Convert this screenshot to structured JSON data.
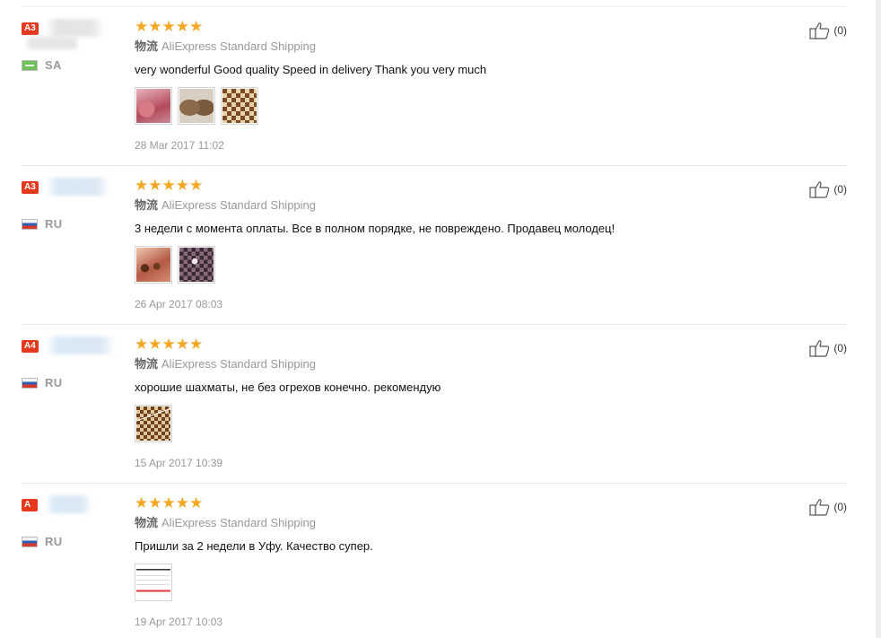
{
  "reviews": [
    {
      "level": "A3",
      "country": "SA",
      "flag": "sa",
      "stars": "★★★★★",
      "shipping_label": "物流",
      "shipping": "AliExpress Standard Shipping",
      "feedback": "very wonderful Good quality Speed in delivery Thank you very much",
      "photos": [
        "ph-pinkbox",
        "ph-bags",
        "ph-board"
      ],
      "date": "28 Mar 2017 11:02",
      "helpful": "(0)"
    },
    {
      "level": "A3",
      "country": "RU",
      "flag": "ru",
      "stars": "★★★★★",
      "shipping_label": "物流",
      "shipping": "AliExpress Standard Shipping",
      "feedback": "3 недели с момента оплаты. Все в полном порядке, не повреждено. Продавец молодец!",
      "photos": [
        "ph-pieces",
        "ph-dark"
      ],
      "date": "26 Apr 2017 08:03",
      "helpful": "(0)"
    },
    {
      "level": "A4",
      "country": "RU",
      "flag": "ru",
      "stars": "★★★★★",
      "shipping_label": "物流",
      "shipping": "AliExpress Standard Shipping",
      "feedback": "хорошие шахматы, не без огрехов конечно. рекомендую",
      "photos": [
        "ph-chessbox"
      ],
      "date": "15 Apr 2017 10:39",
      "helpful": "(0)"
    },
    {
      "level": "A",
      "country": "RU",
      "flag": "ru",
      "stars": "★★★★★",
      "shipping_label": "物流",
      "shipping": "AliExpress Standard Shipping",
      "feedback": "Пришли за 2 недели в Уфу. Качество супер.",
      "photos": [
        "ph-receipt"
      ],
      "date": "19 Apr 2017 10:03",
      "helpful": "(0)"
    }
  ],
  "icons": {
    "helpful": "thumbs-up-icon",
    "rating": "star-icon",
    "flag": "country-flag-icon"
  },
  "colors": {
    "star": "#f5a623",
    "level_badge": "#e4391d",
    "muted_text": "#999999"
  }
}
